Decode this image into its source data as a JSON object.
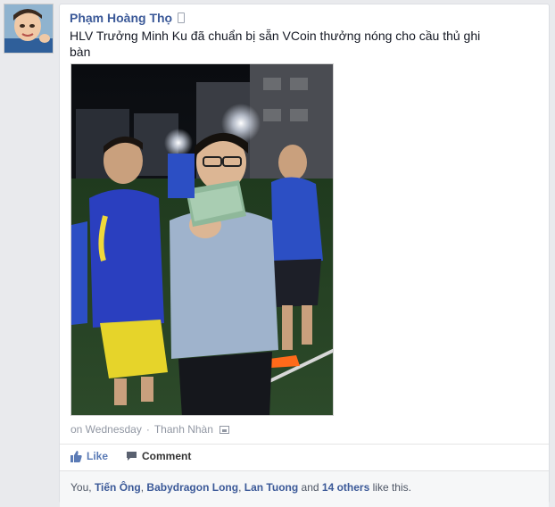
{
  "post": {
    "author": "Phạm Hoàng Thọ",
    "text": "HLV Trưởng Minh Ku đã chuẩn bị sẵn VCoin thưởng nóng cho cầu thủ ghi bàn",
    "timestamp": "on Wednesday",
    "separator": "·",
    "album": "Thanh Nhàn"
  },
  "actions": {
    "like_label": "Like",
    "comment_label": "Comment"
  },
  "likes": {
    "you": "You,",
    "person1": "Tiến Ông",
    "person2": "Babydragon Long",
    "person3": "Lan Tuong",
    "and": "and",
    "others": "14 others",
    "suffix": "like this.",
    "sep": ","
  },
  "colors": {
    "link": "#3b5998",
    "background": "#e9eaed",
    "like_accent": "#5b7bb6"
  }
}
